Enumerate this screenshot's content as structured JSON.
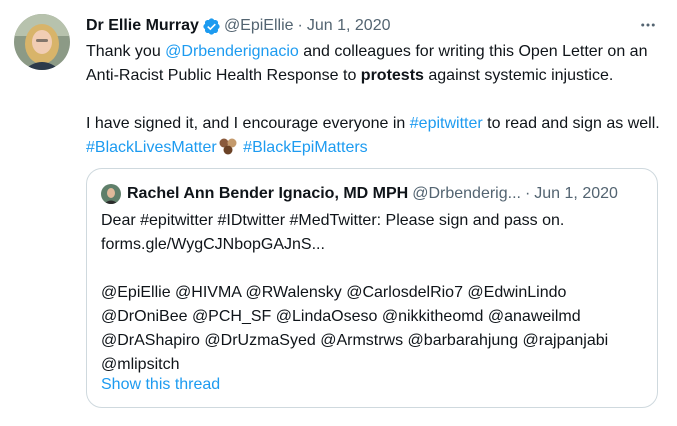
{
  "tweet": {
    "author_name": "Dr Ellie Murray",
    "author_handle": "@EpiEllie",
    "separator": "·",
    "date": "Jun 1, 2020",
    "icons": {
      "verified": "verified-badge-icon",
      "more": "more-options-icon",
      "avatar": "avatar-photo"
    },
    "para1": {
      "t1": "Thank you ",
      "mention": "@Drbenderignacio",
      "t2": " and colleagues for writing this Open Letter on an Anti-Racist Public Health Response to ",
      "bold": "protests",
      "t3": " against systemic injustice."
    },
    "para2": {
      "t1": "I have signed it, and I encourage everyone in ",
      "hashtag1": "#epitwitter",
      "t2": " to read and sign as well. ",
      "hashtag2": "#BlackLivesMatter",
      "hashtag3": "#BlackEpiMatters"
    }
  },
  "quoted": {
    "author_name": "Rachel Ann Bender Ignacio, MD MPH",
    "author_handle": "@Drbenderig...",
    "separator": "·",
    "date": "Jun 1, 2020",
    "line1": "Dear #epitwitter #IDtwitter #MedTwitter:  Please sign and pass on.",
    "line2": "forms.gle/WygCJNbopGAJnS...",
    "mentions": "@EpiEllie @HIVMA @RWalensky @CarlosdelRio7 @EdwinLindo @DrOniBee @PCH_SF @LindaOseso @nikkitheomd @anaweilmd @DrAShapiro @DrUzmaSyed @Armstrws @barbarahjung @rajpanjabi @mlipsitch",
    "show_thread": "Show this thread"
  },
  "colors": {
    "link": "#1d9bf0",
    "muted": "#536471",
    "text": "#0f1419",
    "border": "#cfd9de"
  }
}
